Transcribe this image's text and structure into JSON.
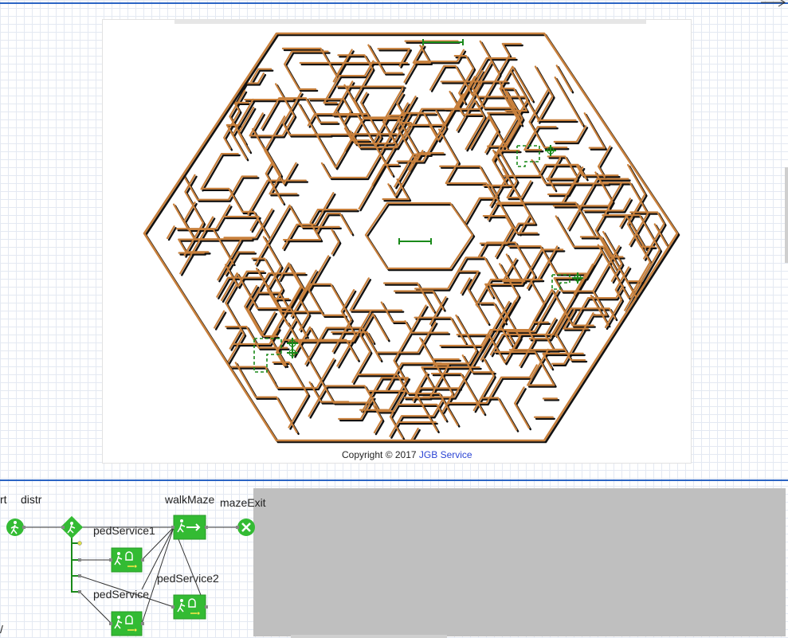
{
  "maze": {
    "copyright_prefix": "Copyright © 2017 ",
    "copyright_link": "JGB Service"
  },
  "flowchart": {
    "blocks": [
      {
        "name": "start-block",
        "label": "rt",
        "icon": "pedestrian-source-icon"
      },
      {
        "name": "distr-block",
        "label": "distr",
        "icon": "pedestrian-select-output-icon"
      },
      {
        "name": "walkmaze-block",
        "label": "walkMaze",
        "icon": "pedestrian-go-to-icon"
      },
      {
        "name": "mazeexit-block",
        "label": "mazeExit",
        "icon": "pedestrian-sink-icon"
      },
      {
        "name": "pedservice1-block",
        "label": "pedService1",
        "icon": "pedestrian-service-icon"
      },
      {
        "name": "pedservice2-block",
        "label": "pedService2",
        "icon": "pedestrian-service-icon"
      },
      {
        "name": "pedservice-block",
        "label": "pedService",
        "icon": "pedestrian-service-icon"
      }
    ],
    "edge_char": "/"
  },
  "colors": {
    "canvas_border": "#2b64c4",
    "maze_wall": "#c8803c",
    "maze_shadow": "#111111",
    "block_green": "#33bb33",
    "area_green": "#1a8a1a",
    "link_blue": "#2b44d4",
    "gray_panel": "#bfbfbf"
  }
}
